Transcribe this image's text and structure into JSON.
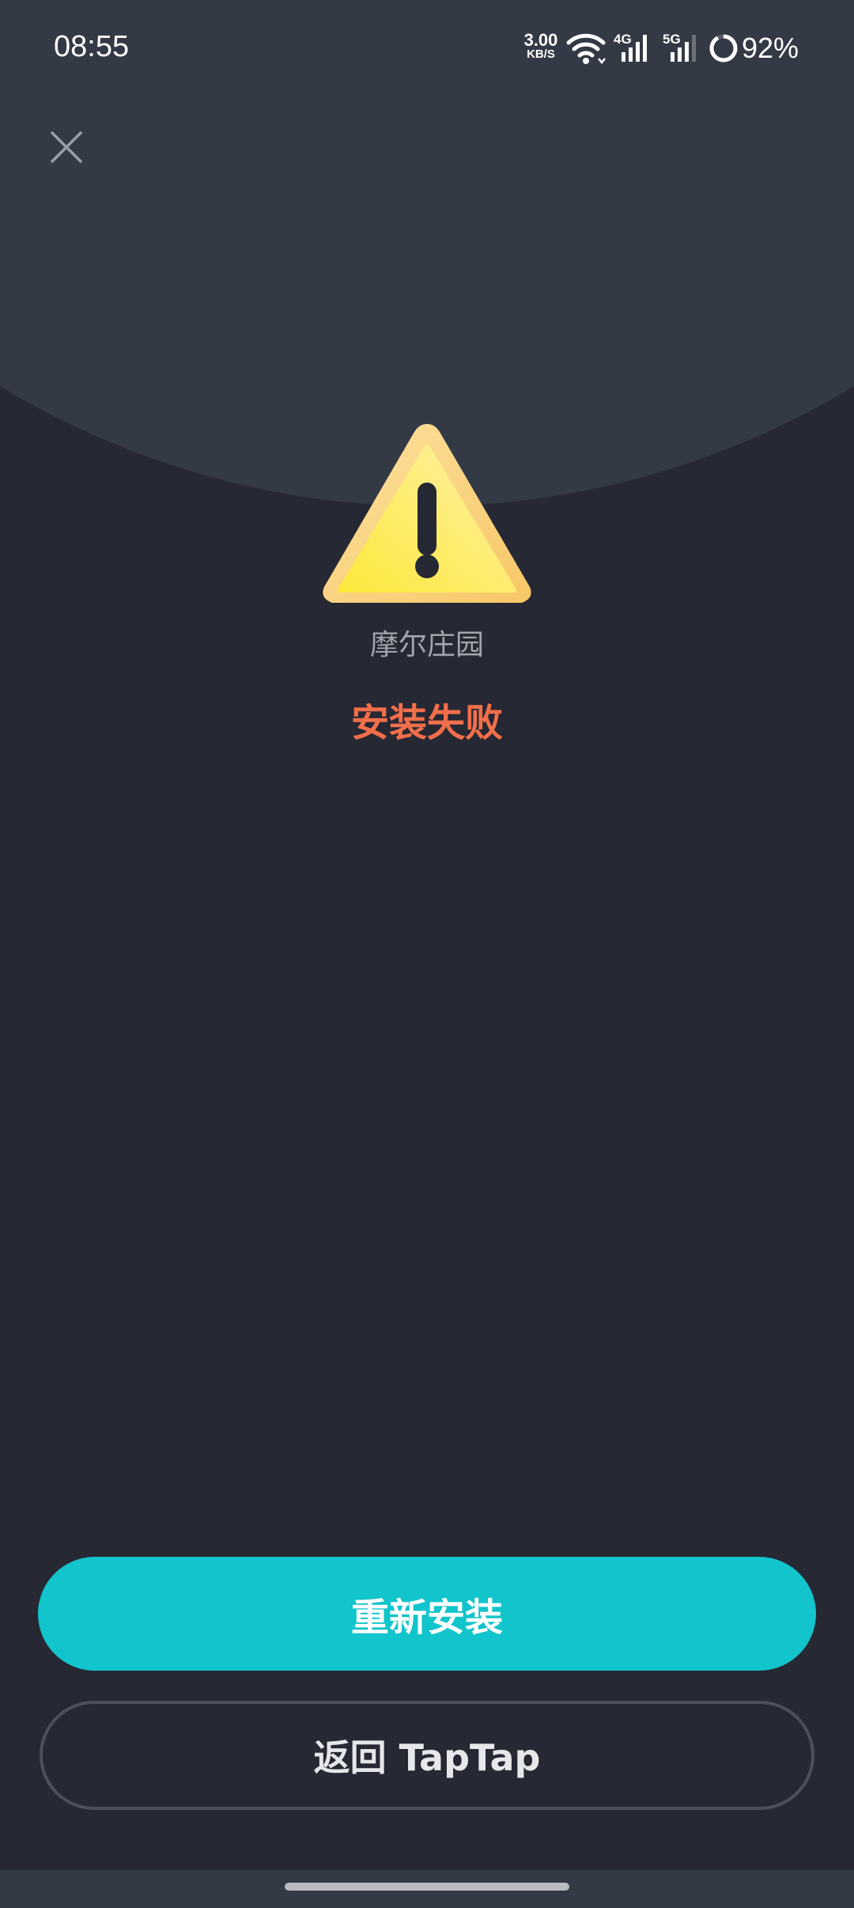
{
  "status_bar": {
    "time": "08:55",
    "net_speed_value": "3.00",
    "net_speed_unit": "KB/S",
    "battery_percent": "92%",
    "battery_level": 0.92,
    "signal_labels": [
      "4G",
      "5G"
    ],
    "icons": [
      "wifi-icon",
      "signal-4g-icon",
      "signal-5g-icon",
      "battery-ring-icon"
    ]
  },
  "header": {
    "close_icon": "close-icon"
  },
  "content": {
    "icon": "warning-triangle-icon",
    "app_name": "摩尔庄园",
    "status_message": "安装失败"
  },
  "actions": {
    "reinstall_label": "重新安装",
    "back_label": "返回 TapTap"
  },
  "colors": {
    "background": "#262833",
    "header_background": "#343946",
    "error_text": "#f26f4b",
    "primary_button": "#12c4cb",
    "warning_yellow": "#fde65a"
  }
}
